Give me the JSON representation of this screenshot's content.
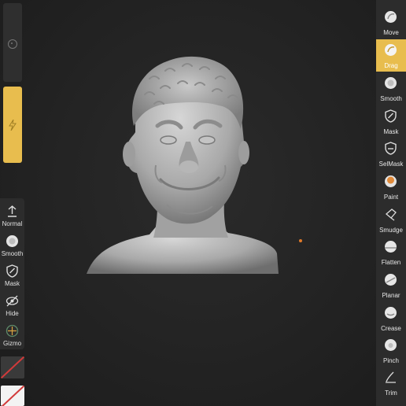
{
  "app": {
    "name": "3D sculpting app viewport"
  },
  "colors": {
    "accent": "#e8bd4e",
    "panel": "#2c2c2c",
    "background": "#232323",
    "pointer": "#e07a2a"
  },
  "left_sliders": [
    {
      "name": "radius",
      "icon": "target-icon"
    },
    {
      "name": "intensity",
      "icon": "lightning-icon",
      "active": true
    }
  ],
  "left_tools": [
    {
      "label": "Normal",
      "icon": "arrow-up-icon"
    },
    {
      "label": "Smooth",
      "icon": "smooth-sphere-icon"
    },
    {
      "label": "Mask",
      "icon": "mask-shield-icon"
    },
    {
      "label": "Hide",
      "icon": "hide-eye-icon"
    },
    {
      "label": "Gizmo",
      "icon": "gizmo-icon"
    }
  ],
  "color_swatches": [
    {
      "name": "color-swatch-dark",
      "icon": "no-color-slash-icon"
    },
    {
      "name": "color-swatch-white",
      "icon": "no-color-slash-icon"
    }
  ],
  "right_tools": [
    {
      "label": "Move",
      "icon": "move-sphere-icon"
    },
    {
      "label": "Drag",
      "icon": "drag-sphere-icon",
      "active": true
    },
    {
      "label": "Smooth",
      "icon": "smooth-sphere-icon"
    },
    {
      "label": "Mask",
      "icon": "mask-shield-icon"
    },
    {
      "label": "SelMask",
      "icon": "selmask-shield-icon"
    },
    {
      "label": "Paint",
      "icon": "paint-sphere-icon"
    },
    {
      "label": "Smudge",
      "icon": "smudge-icon"
    },
    {
      "label": "Flatten",
      "icon": "flatten-sphere-icon"
    },
    {
      "label": "Planar",
      "icon": "planar-sphere-icon"
    },
    {
      "label": "Crease",
      "icon": "crease-sphere-icon"
    },
    {
      "label": "Pinch",
      "icon": "pinch-sphere-icon"
    },
    {
      "label": "Trim",
      "icon": "trim-icon"
    }
  ]
}
